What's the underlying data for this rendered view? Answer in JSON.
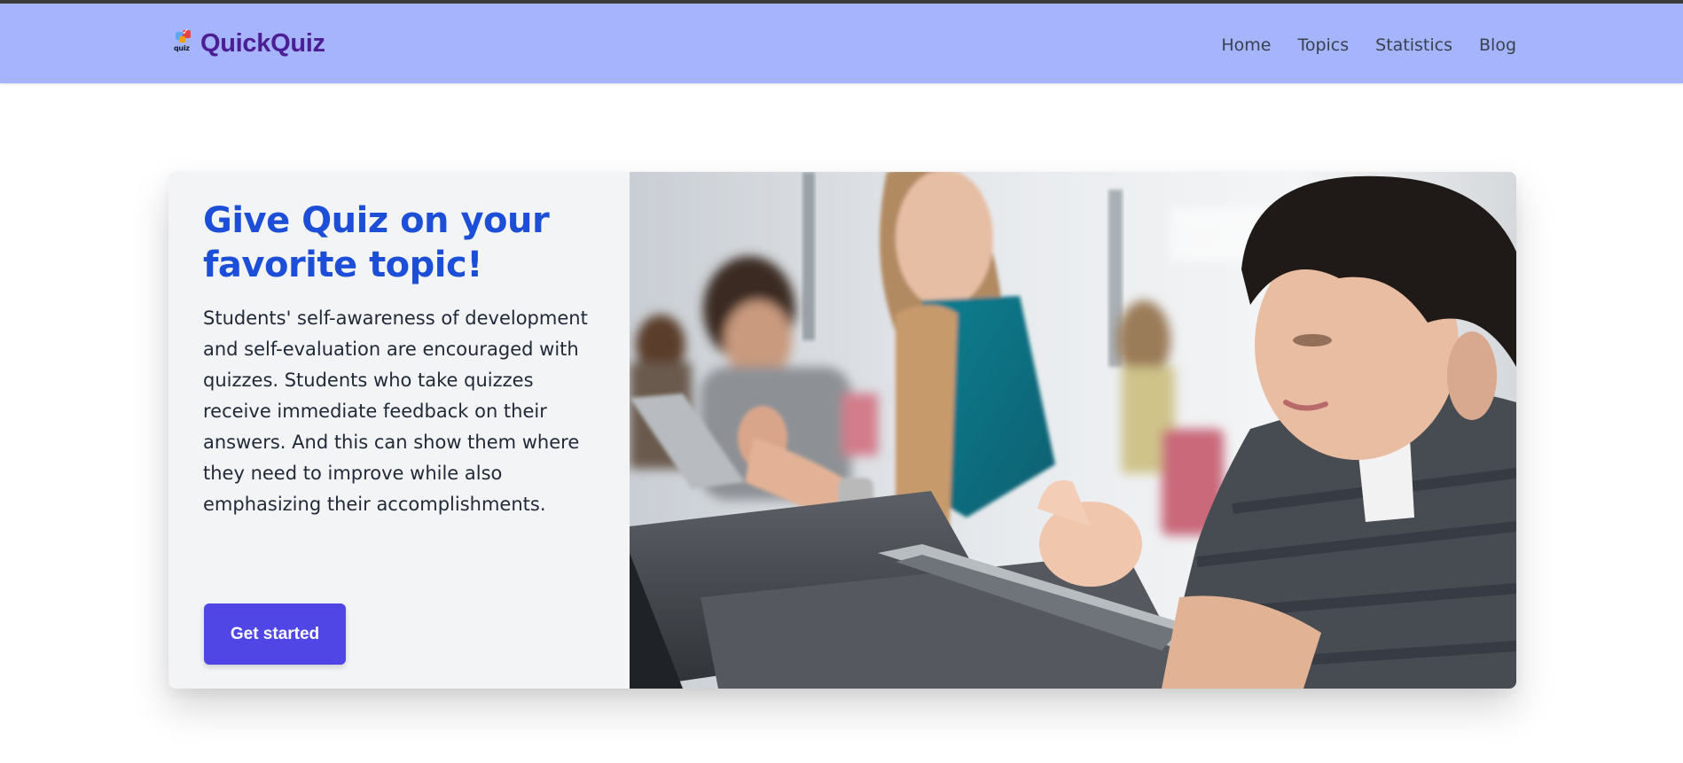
{
  "brand": {
    "logo_text": "quiz",
    "name": "QuickQuiz"
  },
  "nav": {
    "items": [
      {
        "label": "Home"
      },
      {
        "label": "Topics"
      },
      {
        "label": "Statistics"
      },
      {
        "label": "Blog"
      }
    ]
  },
  "hero": {
    "title": "Give Quiz on your favorite topic!",
    "description": "Students' self-awareness of development and self-evaluation are encouraged with quizzes. Students who take quizzes receive immediate feedback on their answers. And this can show them where they need to improve while also emphasizing their accomplishments.",
    "cta_label": "Get started"
  },
  "colors": {
    "navbar_bg": "#a5b4fc",
    "brand": "#4c1d95",
    "title": "#1d4ed8",
    "cta_bg": "#4f46e5"
  }
}
